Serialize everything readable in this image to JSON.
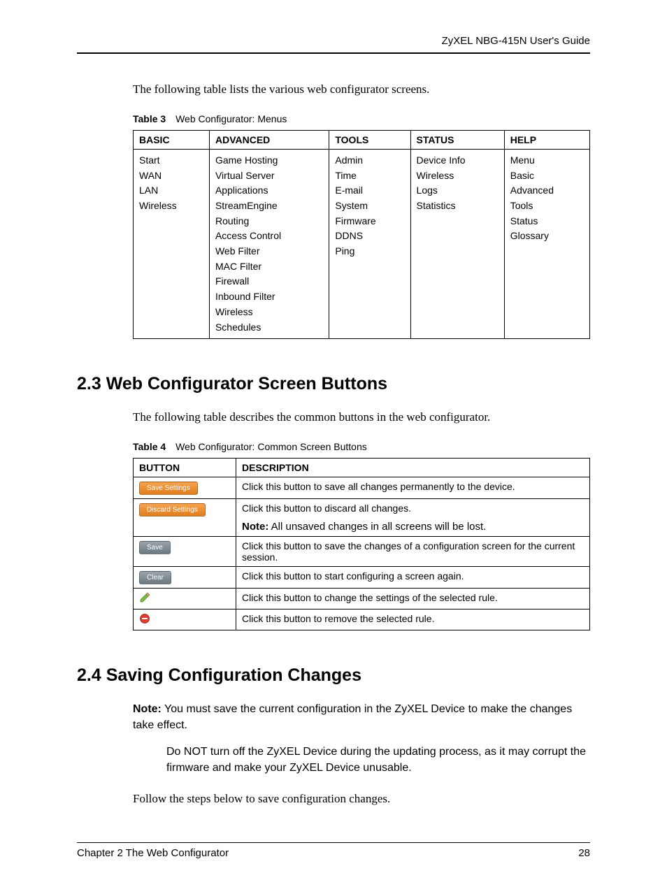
{
  "header": "ZyXEL NBG-415N User's Guide",
  "intro1": "The following table lists the various web configurator screens.",
  "table3": {
    "caption_label": "Table 3",
    "caption_title": "Web Configurator: Menus",
    "headers": [
      "BASIC",
      "ADVANCED",
      "TOOLS",
      "STATUS",
      "HELP"
    ],
    "cols": [
      [
        "Start",
        "WAN",
        "LAN",
        "Wireless"
      ],
      [
        "Game Hosting",
        "Virtual Server",
        "Applications",
        "StreamEngine",
        "Routing",
        "Access Control",
        "Web Filter",
        "MAC Filter",
        "Firewall",
        "Inbound Filter",
        "Wireless",
        "Schedules"
      ],
      [
        "Admin",
        "Time",
        "E-mail",
        "System",
        "Firmware",
        "DDNS",
        "Ping"
      ],
      [
        "Device Info",
        "Wireless",
        "Logs",
        "Statistics"
      ],
      [
        "Menu",
        "Basic",
        "Advanced",
        "Tools",
        "Status",
        "Glossary"
      ]
    ]
  },
  "section23": {
    "heading": "2.3  Web Configurator Screen Buttons",
    "intro": "The following table describes the common buttons in the web configurator."
  },
  "table4": {
    "caption_label": "Table 4",
    "caption_title": "Web Configurator: Common Screen Buttons",
    "headers": [
      "BUTTON",
      "DESCRIPTION"
    ],
    "rows": [
      {
        "btn_label": "Save Settings",
        "btn_style": "orange",
        "desc": "Click this button to save all changes permanently to the device."
      },
      {
        "btn_label": "Discard Settings",
        "btn_style": "orange",
        "desc": "Click this button to discard all changes.",
        "note_prefix": "Note:",
        "note_text": " All unsaved changes in all screens will be lost."
      },
      {
        "btn_label": "Save",
        "btn_style": "grey",
        "desc": "Click this button to save the changes of a configuration screen for the current session."
      },
      {
        "btn_label": "Clear",
        "btn_style": "grey",
        "desc": "Click this button to start configuring a screen again."
      },
      {
        "icon": "edit",
        "desc": "Click this button to change the settings of the selected rule."
      },
      {
        "icon": "delete",
        "desc": "Click this button to remove the selected rule."
      }
    ]
  },
  "section24": {
    "heading": "2.4  Saving Configuration Changes",
    "note_prefix": "Note:",
    "note_line1": " You must save the current configuration in the ZyXEL Device to make the changes take effect.",
    "note_line2": "Do NOT turn off the ZyXEL Device during the updating process, as it may corrupt the firmware and make your ZyXEL Device unusable.",
    "body": "Follow the steps below to save configuration changes."
  },
  "footer": {
    "left": "Chapter 2 The Web Configurator",
    "right": "28"
  }
}
